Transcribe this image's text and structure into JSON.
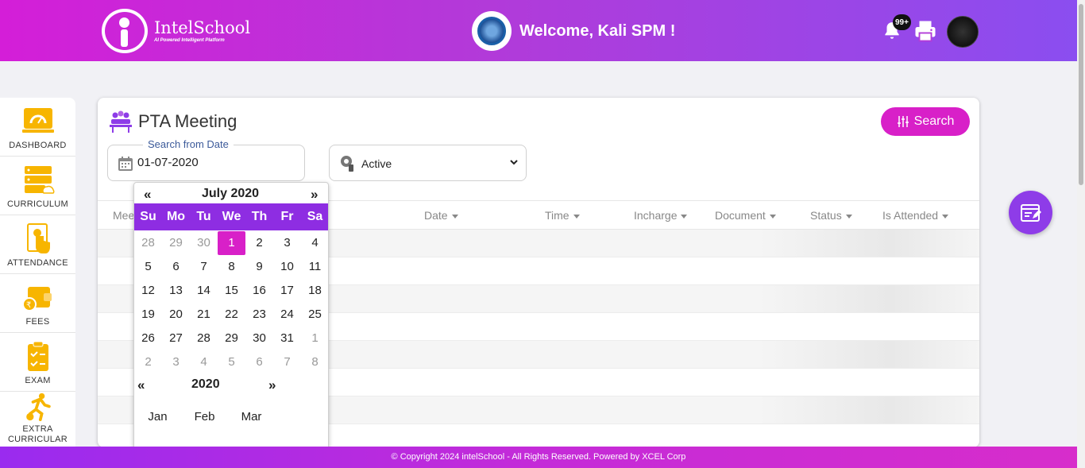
{
  "header": {
    "brand_name": "IntelSchool",
    "brand_tagline": "AI Powered Intelligent Platform",
    "welcome": "Welcome, Kali SPM !",
    "notification_count": "99+"
  },
  "sidebar": {
    "items": [
      {
        "label": "DASHBOARD",
        "icon": "dashboard-icon"
      },
      {
        "label": "CURRICULUM",
        "icon": "server-icon"
      },
      {
        "label": "ATTENDANCE",
        "icon": "attendance-icon"
      },
      {
        "label": "FEES",
        "icon": "wallet-icon"
      },
      {
        "label": "EXAM",
        "icon": "clipboard-icon"
      },
      {
        "label": "EXTRA CURRICULAR",
        "icon": "running-icon"
      }
    ]
  },
  "page": {
    "title": "PTA Meeting",
    "search_button": "Search",
    "date_field_label": "Search from Date",
    "date_value": "01-07-2020",
    "status_value": "Active"
  },
  "table": {
    "columns": [
      "Mee",
      "Date",
      "Time",
      "Incharge",
      "Document",
      "Status",
      "Is Attended"
    ]
  },
  "calendar": {
    "prev": "«",
    "next": "»",
    "month_title": "July 2020",
    "weekdays": [
      "Su",
      "Mo",
      "Tu",
      "We",
      "Th",
      "Fr",
      "Sa"
    ],
    "weeks": [
      [
        "28",
        "29",
        "30",
        "1",
        "2",
        "3",
        "4"
      ],
      [
        "5",
        "6",
        "7",
        "8",
        "9",
        "10",
        "11"
      ],
      [
        "12",
        "13",
        "14",
        "15",
        "16",
        "17",
        "18"
      ],
      [
        "19",
        "20",
        "21",
        "22",
        "23",
        "24",
        "25"
      ],
      [
        "26",
        "27",
        "28",
        "29",
        "30",
        "31",
        "1"
      ],
      [
        "2",
        "3",
        "4",
        "5",
        "6",
        "7",
        "8"
      ]
    ],
    "selected_day": "1",
    "year_title": "2020",
    "months": [
      "Jan",
      "Feb",
      "Mar"
    ]
  },
  "footer": {
    "text": "© Copyright 2024 intelSchool - All Rights Reserved. Powered by XCEL Corp"
  },
  "colors": {
    "accent": "#d820c8",
    "purple": "#8e2de2",
    "sidebar_icon": "#f7b500"
  }
}
